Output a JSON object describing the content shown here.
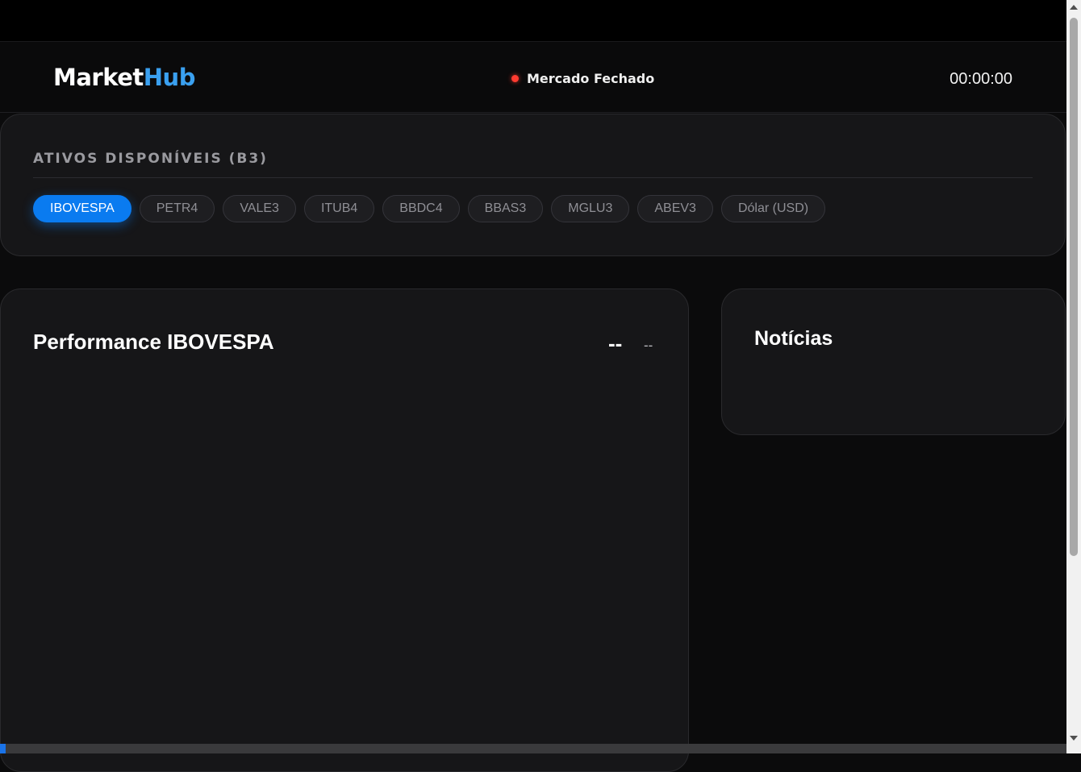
{
  "header": {
    "logo_part1": "Market",
    "logo_part2": "Hub",
    "market_status": "Mercado Fechado",
    "clock": "00:00:00"
  },
  "assets": {
    "title": "ATIVOS DISPONÍVEIS (B3)",
    "chips": [
      {
        "label": "IBOVESPA",
        "active": true
      },
      {
        "label": "PETR4",
        "active": false
      },
      {
        "label": "VALE3",
        "active": false
      },
      {
        "label": "ITUB4",
        "active": false
      },
      {
        "label": "BBDC4",
        "active": false
      },
      {
        "label": "BBAS3",
        "active": false
      },
      {
        "label": "MGLU3",
        "active": false
      },
      {
        "label": "ABEV3",
        "active": false
      },
      {
        "label": "Dólar (USD)",
        "active": false
      }
    ]
  },
  "performance": {
    "title": "Performance IBOVESPA",
    "value": "--",
    "change": "--"
  },
  "news": {
    "title": "Notícias"
  },
  "loading_progress": 0.005,
  "colors": {
    "accent": "#0a7bf0",
    "logo_accent": "#3aa0f0",
    "status_closed": "#ff3b30"
  }
}
